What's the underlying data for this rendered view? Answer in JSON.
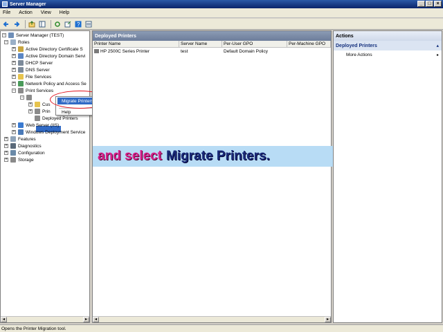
{
  "window": {
    "title": "Server Manager",
    "buttons": [
      "_",
      "□",
      "×"
    ]
  },
  "menu": [
    "File",
    "Action",
    "View",
    "Help"
  ],
  "toolbar_icons": [
    "back-icon",
    "forward-icon",
    "up-icon",
    "show-tree-icon",
    "refresh-icon",
    "export-icon",
    "help-icon",
    "properties-icon"
  ],
  "tree": {
    "items": [
      {
        "label": "Server Manager (TEST)",
        "exp": "−"
      },
      {
        "label": "Roles",
        "exp": "−"
      },
      {
        "label": "Active Directory Certificate S",
        "exp": "+"
      },
      {
        "label": "Active Directory Domain Servi",
        "exp": "+"
      },
      {
        "label": "DHCP Server",
        "exp": "+"
      },
      {
        "label": "DNS Server",
        "exp": "+"
      },
      {
        "label": "File Services",
        "exp": "+"
      },
      {
        "label": "Network Policy and Access Se",
        "exp": "+"
      },
      {
        "label": "Print Services",
        "exp": "−"
      },
      {
        "label": "Print Ma",
        "exp": "−"
      },
      {
        "label": "Cus",
        "exp": "+"
      },
      {
        "label": "Prin",
        "exp": "+"
      },
      {
        "label": "Deployed Printers",
        "exp": ""
      },
      {
        "label": "Web Server (IIS)",
        "exp": "+"
      },
      {
        "label": "Windows Deployment Service",
        "exp": "+"
      },
      {
        "label": "Features",
        "exp": "+"
      },
      {
        "label": "Diagnostics",
        "exp": "+"
      },
      {
        "label": "Configuration",
        "exp": "+"
      },
      {
        "label": "Storage",
        "exp": "+"
      }
    ]
  },
  "context_menu": {
    "items": [
      "Migrate Printers...",
      "Help"
    ]
  },
  "center": {
    "title": "Deployed Printers",
    "columns": [
      "Printer Name",
      "Server Name",
      "Per-User GPO",
      "Per-Machine GPO"
    ],
    "rows": [
      {
        "printer": "HP 2500C Series Printer",
        "server": "test",
        "user_gpo": "Default Domain Policy",
        "machine_gpo": ""
      }
    ]
  },
  "caption": {
    "part1": "and select",
    "part2": "Migrate Printers."
  },
  "actions": {
    "title": "Actions",
    "section": "Deployed Printers",
    "items": [
      "More Actions"
    ]
  },
  "status": "Opens the Printer Migration tool.",
  "colors": {
    "selection": "#316ac5",
    "highlight_ellipse": "#e0101a",
    "caption_bg": "#b8dcf5",
    "caption_pink": "#d8208a",
    "caption_navy": "#1a2a7a"
  }
}
